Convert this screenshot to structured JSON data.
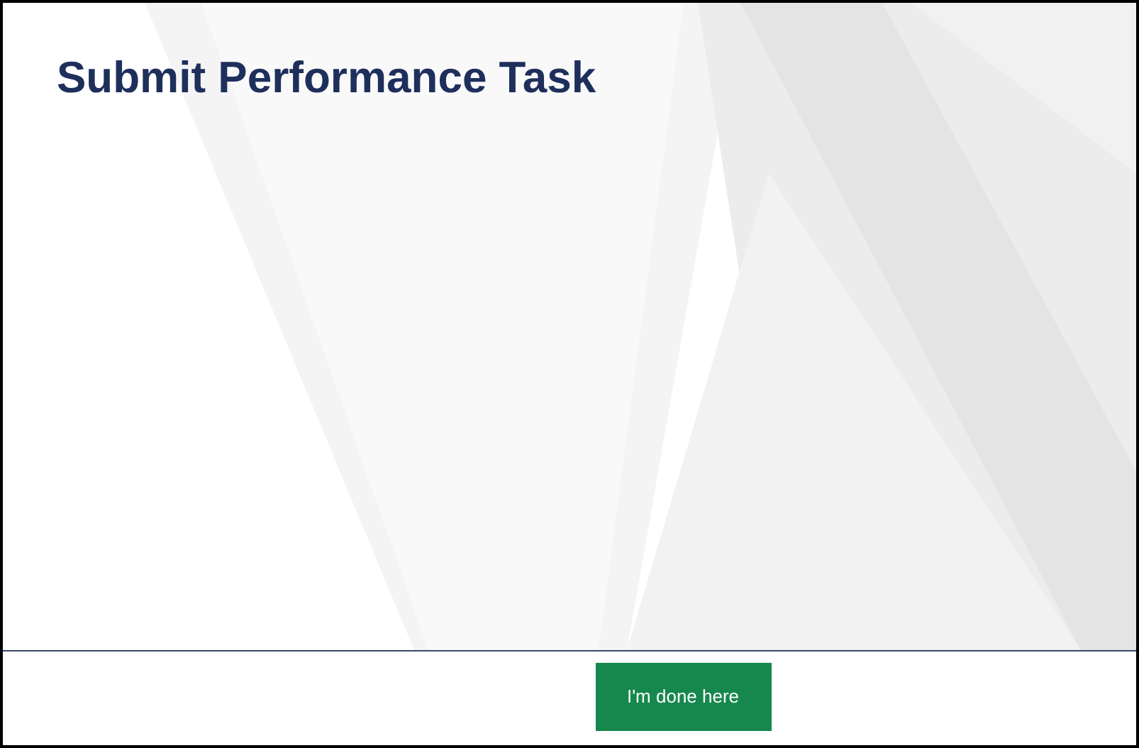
{
  "title": "Submit Performance Task",
  "footer": {
    "button": "I'm done here"
  }
}
